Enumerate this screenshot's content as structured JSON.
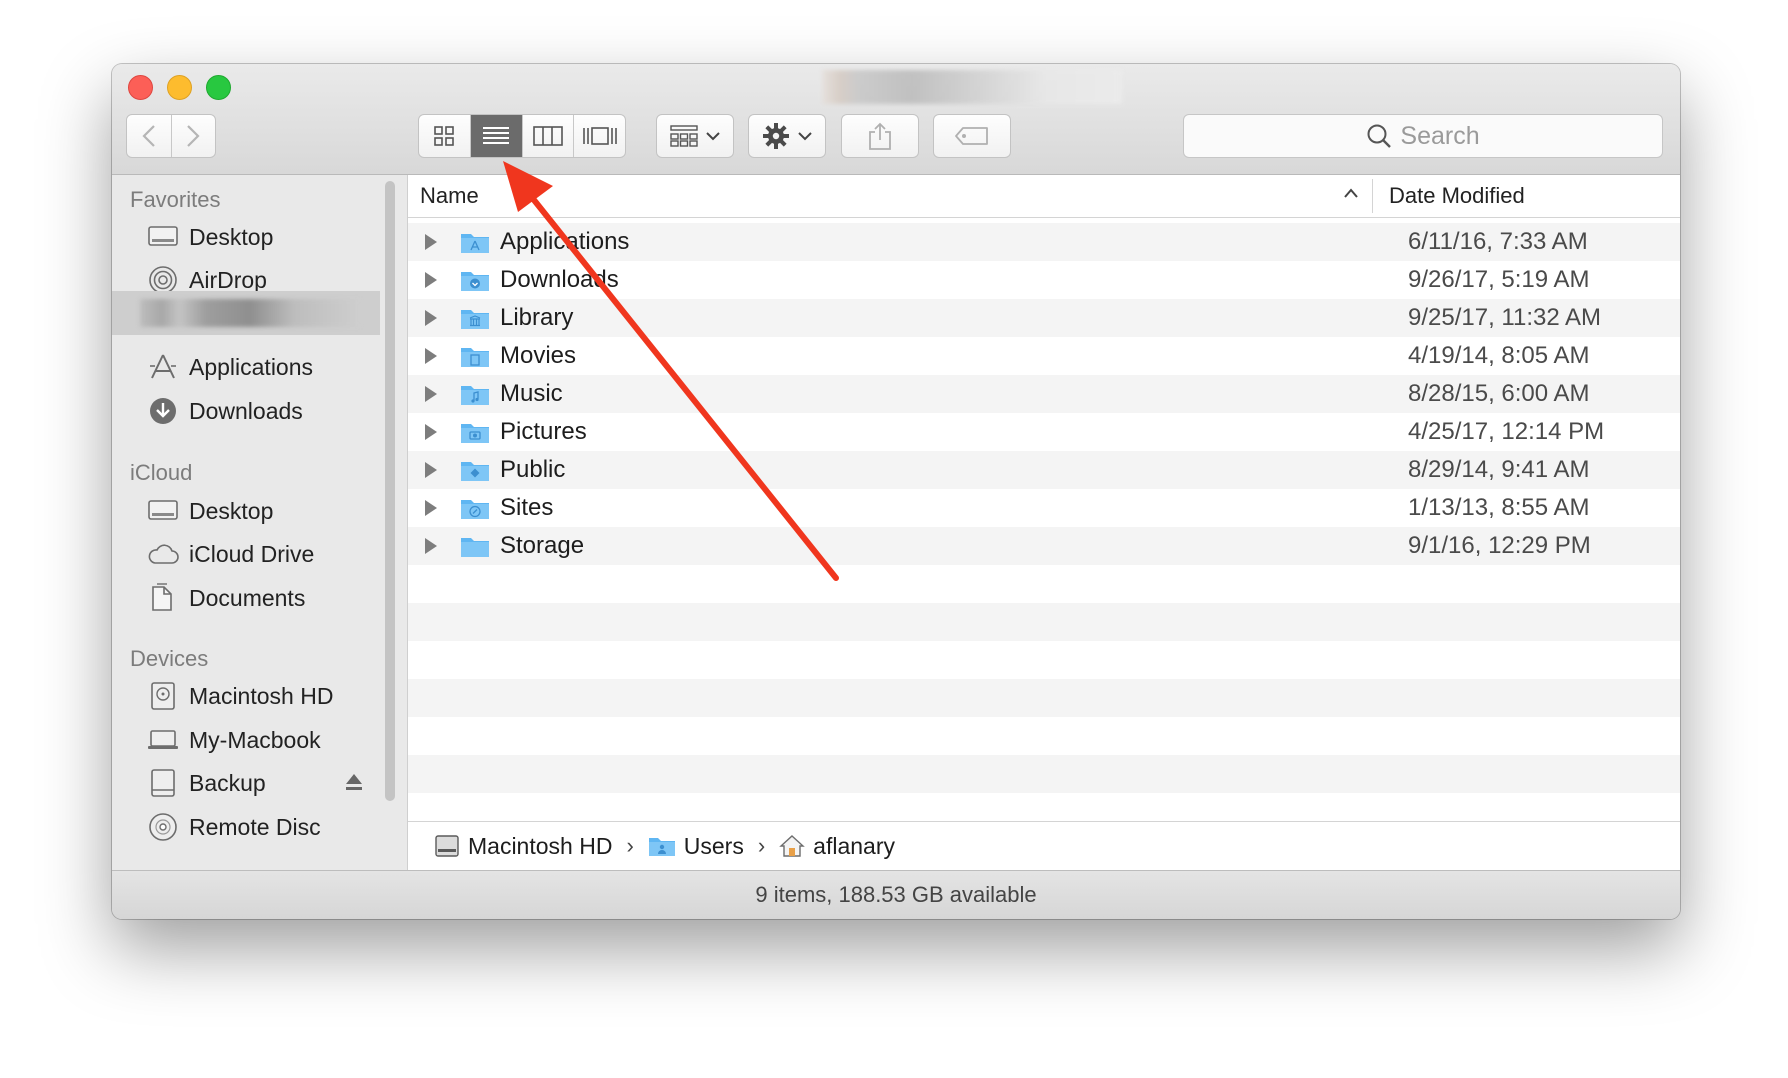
{
  "window": {
    "title": "",
    "search_placeholder": "Search"
  },
  "sidebar": {
    "sections": [
      {
        "label": "Favorites",
        "items": [
          {
            "label": "Desktop",
            "icon": "desktop-icon"
          },
          {
            "label": "AirDrop",
            "icon": "airdrop-icon"
          },
          {
            "label": "",
            "icon": "home-icon"
          },
          {
            "label": "Applications",
            "icon": "applications-icon"
          },
          {
            "label": "Downloads",
            "icon": "downloads-icon"
          }
        ]
      },
      {
        "label": "iCloud",
        "items": [
          {
            "label": "Desktop",
            "icon": "desktop-icon"
          },
          {
            "label": "iCloud Drive",
            "icon": "cloud-icon"
          },
          {
            "label": "Documents",
            "icon": "documents-icon"
          }
        ]
      },
      {
        "label": "Devices",
        "items": [
          {
            "label": "Macintosh HD",
            "icon": "hard-drive-icon"
          },
          {
            "label": "My-Macbook",
            "icon": "laptop-icon"
          },
          {
            "label": "Backup",
            "icon": "external-drive-icon"
          },
          {
            "label": "Remote Disc",
            "icon": "disc-icon"
          }
        ]
      }
    ]
  },
  "list": {
    "columns": {
      "name": "Name",
      "date": "Date Modified"
    },
    "rows": [
      {
        "name": "Applications",
        "date": "6/11/16, 7:33 AM",
        "icon": "applications-folder-icon"
      },
      {
        "name": "Downloads",
        "date": "9/26/17, 5:19 AM",
        "icon": "downloads-folder-icon"
      },
      {
        "name": "Library",
        "date": "9/25/17, 11:32 AM",
        "icon": "library-folder-icon"
      },
      {
        "name": "Movies",
        "date": "4/19/14, 8:05 AM",
        "icon": "movies-folder-icon"
      },
      {
        "name": "Music",
        "date": "8/28/15, 6:00 AM",
        "icon": "music-folder-icon"
      },
      {
        "name": "Pictures",
        "date": "4/25/17, 12:14 PM",
        "icon": "pictures-folder-icon"
      },
      {
        "name": "Public",
        "date": "8/29/14, 9:41 AM",
        "icon": "public-folder-icon"
      },
      {
        "name": "Sites",
        "date": "1/13/13, 8:55 AM",
        "icon": "sites-folder-icon"
      },
      {
        "name": "Storage",
        "date": "9/1/16, 12:29 PM",
        "icon": "folder-icon"
      }
    ]
  },
  "path": [
    "Macintosh HD",
    "Users",
    "aflanary"
  ],
  "status": "9 items, 188.53 GB available",
  "colors": {
    "accent_folder": "#5fb6f2",
    "annotation_arrow": "#f0361e",
    "active_segment": "#6b6b6b"
  }
}
